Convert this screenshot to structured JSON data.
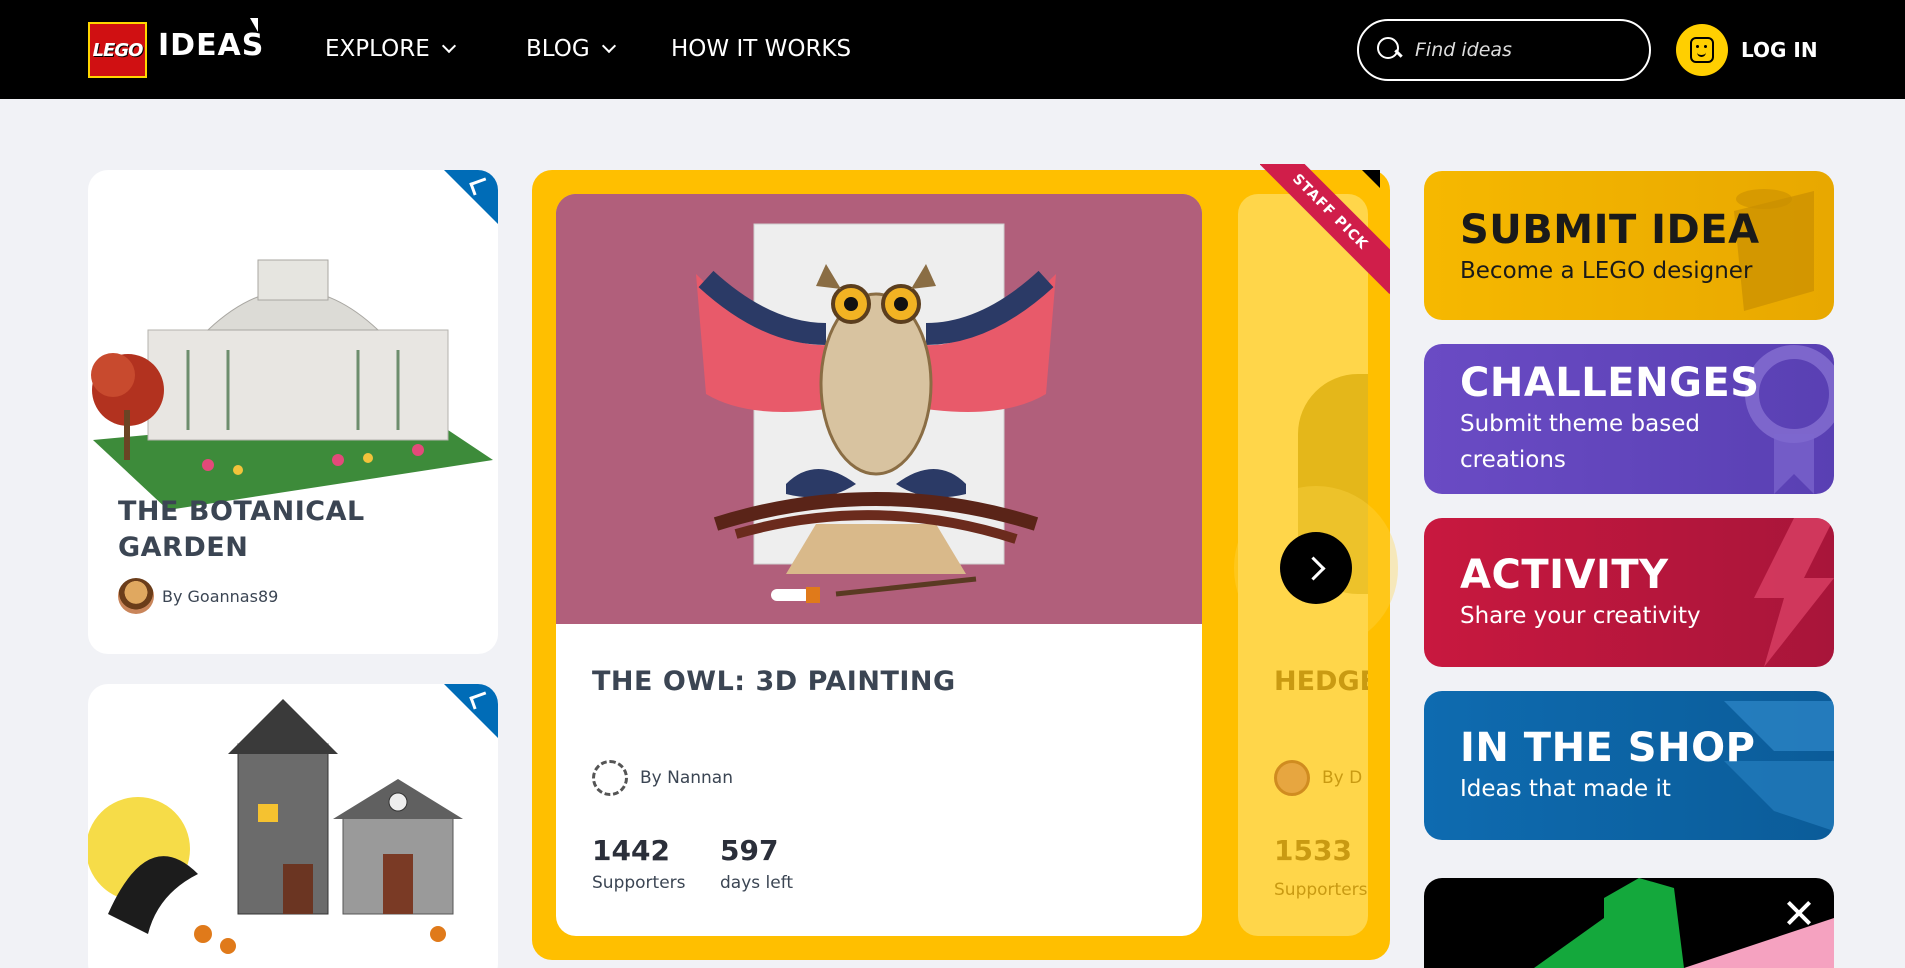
{
  "header": {
    "logo_brand": "LEGO",
    "logo_text": "IDEAS",
    "nav": [
      {
        "label": "EXPLORE"
      },
      {
        "label": "BLOG"
      },
      {
        "label": "HOW IT WORKS"
      }
    ],
    "search_placeholder": "Find ideas",
    "login_label": "LOG IN"
  },
  "left_cards": [
    {
      "title": "THE BOTANICAL GARDEN",
      "author": "By Goannas89"
    },
    {
      "title": "",
      "author": ""
    }
  ],
  "featured": {
    "ribbon": "STAFF PICK",
    "current": {
      "title": "THE OWL: 3D PAINTING",
      "author": "By Nannan",
      "supporters": "1442",
      "supporters_label": "Supporters",
      "days": "597",
      "days_label": "days left"
    },
    "next": {
      "title": "HEDGE",
      "author": "By D",
      "supporters": "1533",
      "supporters_label": "Supporters"
    }
  },
  "tiles": [
    {
      "title": "SUBMIT IDEA",
      "subtitle": "Become a LEGO designer",
      "color": "#f6b800"
    },
    {
      "title": "CHALLENGES",
      "subtitle": "Submit theme based creations",
      "color": "#6a4bc4"
    },
    {
      "title": "ACTIVITY",
      "subtitle": "Share your creativity",
      "color": "#c8183f"
    },
    {
      "title": "IN THE SHOP",
      "subtitle": "Ideas that made it",
      "color": "#0e6bb0"
    }
  ],
  "colors": {
    "header_bg": "#000000",
    "accent_yellow": "#ffbf00",
    "lego_red": "#d01012",
    "badge_blue": "#006cb7"
  }
}
